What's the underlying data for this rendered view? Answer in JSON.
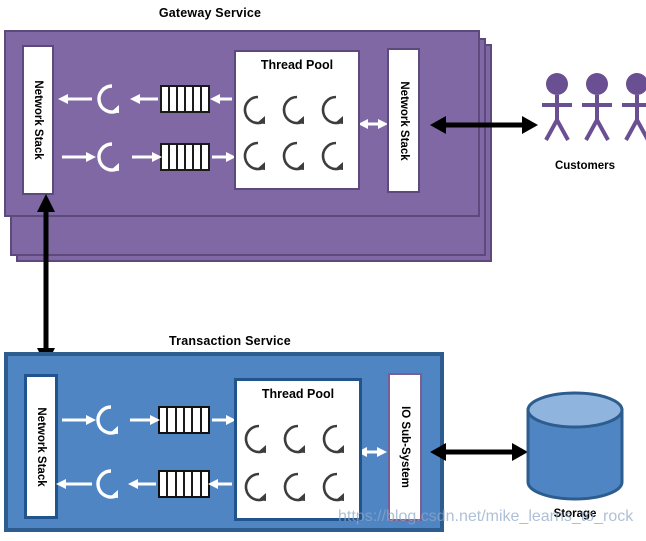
{
  "diagram": {
    "title_gateway": "Gateway Service",
    "title_transaction": "Transaction Service",
    "watermark": "https://blog.csdn.net/mike_learns_to_rock"
  },
  "gateway": {
    "label": "Gateway Service",
    "stack_copies": 3,
    "network_stack_in": "Network Stack",
    "network_stack_out": "Network Stack",
    "thread_pool": {
      "label": "Thread Pool",
      "thread_count": 6,
      "rows": 2,
      "cols": 3
    },
    "queues": [
      {
        "name": "inbound-queue",
        "slots": 6,
        "direction": "left"
      },
      {
        "name": "outbound-queue",
        "slots": 6,
        "direction": "right"
      }
    ],
    "loops": [
      {
        "name": "upper-loop"
      },
      {
        "name": "lower-loop"
      }
    ]
  },
  "transaction": {
    "label": "Transaction Service",
    "network_stack": "Network Stack",
    "io_subsystem": "IO Sub-System",
    "thread_pool": {
      "label": "Thread Pool",
      "thread_count": 6,
      "rows": 2,
      "cols": 3
    },
    "queues": [
      {
        "name": "request-queue",
        "slots": 6,
        "direction": "right"
      },
      {
        "name": "response-queue",
        "slots": 6,
        "direction": "left"
      }
    ]
  },
  "customers": {
    "label": "Customers",
    "count": 3
  },
  "storage": {
    "label": "Storage"
  },
  "colors": {
    "purple_fill": "#7f68a4",
    "purple_border": "#5c4a7d",
    "blue_fill": "#5085c3",
    "blue_border": "#2d5c8e",
    "storage_body": "#5085c3",
    "storage_top": "#8fb4dd",
    "storage_stroke": "#2d5c8e",
    "person_color": "#6b4f93",
    "arrow_black": "#000000",
    "arrow_white": "#ffffff",
    "watermark_color": "#8fa8c8"
  }
}
